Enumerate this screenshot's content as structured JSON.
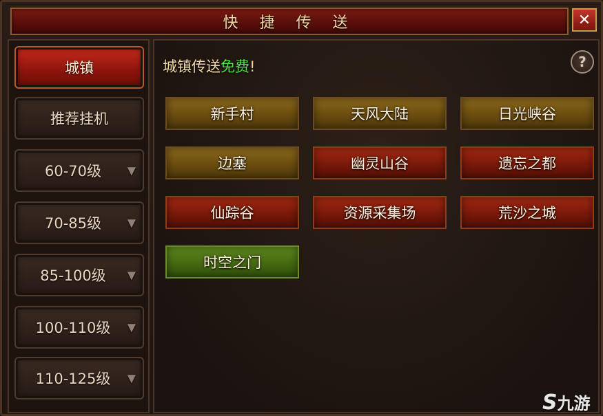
{
  "window": {
    "title": "快 捷 传 送",
    "close_label": "✕"
  },
  "sidebar": {
    "items": [
      {
        "label": "城镇",
        "active": true
      },
      {
        "label": "推荐挂机"
      },
      {
        "label": "60-70级",
        "arrow": "▼"
      },
      {
        "label": "70-85级",
        "arrow": "▼"
      },
      {
        "label": "85-100级",
        "arrow": "▼"
      },
      {
        "label": "100-110级",
        "arrow": "▼"
      },
      {
        "label": "110-125级",
        "arrow": "▼"
      }
    ]
  },
  "main": {
    "notice_prefix": "城镇传送",
    "notice_free": "免费",
    "notice_suffix": "!",
    "help_label": "?",
    "destinations": [
      {
        "label": "新手村",
        "style": "gold"
      },
      {
        "label": "天风大陆",
        "style": "gold"
      },
      {
        "label": "日光峡谷",
        "style": "gold"
      },
      {
        "label": "边塞",
        "style": "gold"
      },
      {
        "label": "幽灵山谷",
        "style": "red"
      },
      {
        "label": "遗忘之都",
        "style": "red"
      },
      {
        "label": "仙踪谷",
        "style": "red"
      },
      {
        "label": "资源采集场",
        "style": "red"
      },
      {
        "label": "荒沙之城",
        "style": "red"
      },
      {
        "label": "时空之门",
        "style": "green"
      }
    ]
  },
  "watermark": {
    "glyph": "S",
    "text": "九游"
  },
  "colors": {
    "free_text": "#4fe34a",
    "active_tab": "#c52a1c",
    "title_bar": "#7a1a12"
  }
}
